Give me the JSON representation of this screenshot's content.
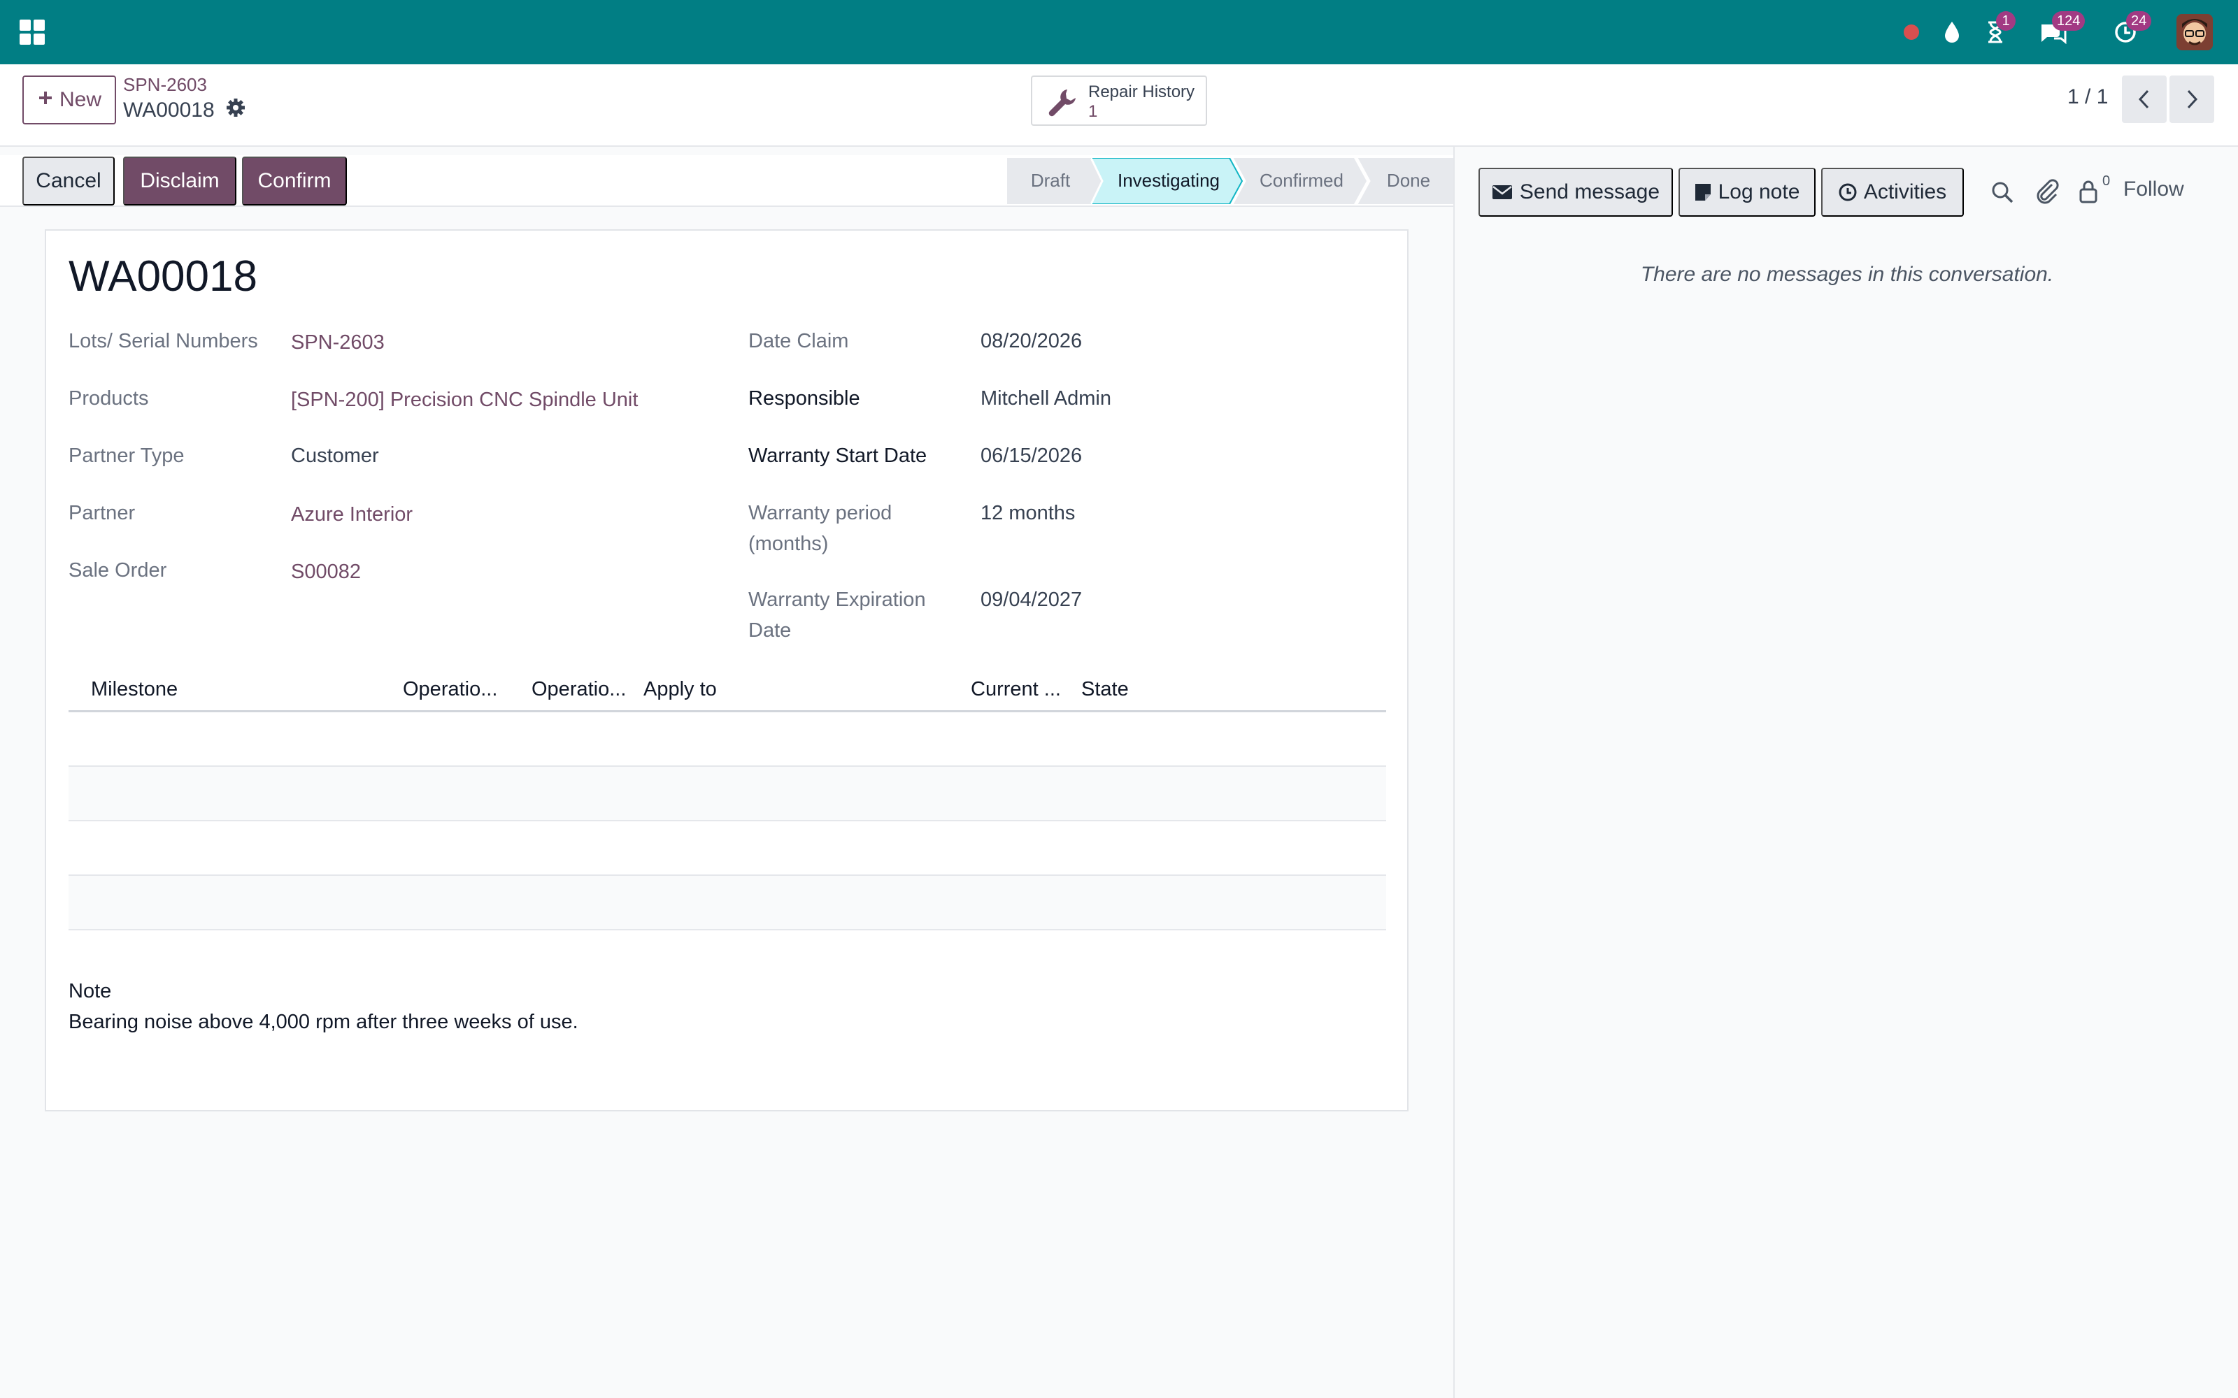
{
  "navbar": {
    "badges": {
      "activities": "1",
      "messages": "124",
      "clock": "24"
    },
    "accent": "#017e84"
  },
  "control_panel": {
    "new_label": "New",
    "breadcrumb_parent": "SPN-2603",
    "breadcrumb_current": "WA00018",
    "smart_button": {
      "label": "Repair History",
      "count": "1"
    },
    "pager": "1 / 1"
  },
  "actions": {
    "cancel": "Cancel",
    "disclaim": "Disclaim",
    "confirm": "Confirm"
  },
  "stages": [
    "Draft",
    "Investigating",
    "Confirmed",
    "Done"
  ],
  "active_stage": "Investigating",
  "chatter": {
    "send_message": "Send message",
    "log_note": "Log note",
    "activities": "Activities",
    "follower_count": "0",
    "follow": "Follow",
    "empty": "There are no messages in this conversation."
  },
  "record": {
    "title": "WA00018",
    "left": [
      {
        "label": "Lots/ Serial Numbers",
        "value": "SPN-2603"
      },
      {
        "label": "Products",
        "value": "[SPN-200] Precision CNC Spindle Unit"
      },
      {
        "label": "Partner Type",
        "value": "Customer"
      },
      {
        "label": "Partner",
        "value": "Azure Interior"
      },
      {
        "label": "Sale Order",
        "value": "S00082"
      }
    ],
    "right": [
      {
        "label": "Date Claim",
        "value": "08/20/2026"
      },
      {
        "label": "Responsible",
        "value": "Mitchell Admin"
      },
      {
        "label": "Warranty Start Date",
        "value": "06/15/2026"
      },
      {
        "label": "Warranty period (months)",
        "value": "12 months"
      },
      {
        "label": "Warranty Expiration Date",
        "value": "09/04/2027"
      }
    ],
    "table_headers": [
      "Milestone",
      "Operatio...",
      "Operatio...",
      "Apply to",
      "Current ...",
      "State"
    ],
    "note_label": "Note",
    "note_text": "Bearing noise above 4,000 rpm after three weeks of use."
  }
}
